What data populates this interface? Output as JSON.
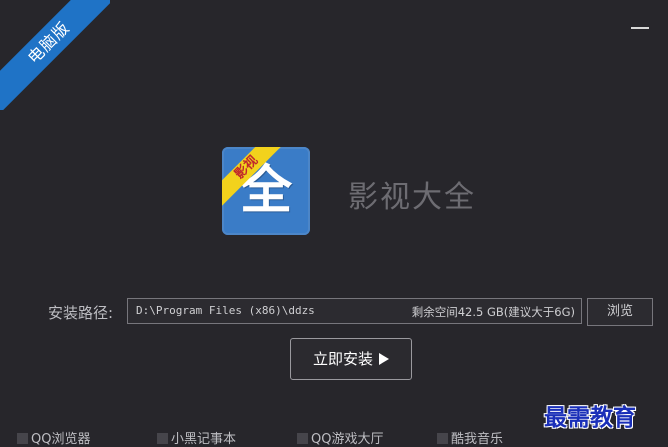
{
  "corner_ribbon": {
    "label": "电脑版"
  },
  "logo": {
    "char": "全",
    "band_label": "影视"
  },
  "app": {
    "name": "影视大全"
  },
  "install": {
    "path_label": "安装路径:",
    "path_value": "D:\\Program Files (x86)\\ddzs",
    "space_info": "剩余空间42.5 GB(建议大于6G)",
    "browse_label": "浏览",
    "install_label": "立即安装"
  },
  "bundles": [
    {
      "label": "QQ浏览器",
      "checked": false
    },
    {
      "label": "小黑记事本",
      "checked": false
    },
    {
      "label": "QQ游戏大厅",
      "checked": false
    },
    {
      "label": "酷我音乐",
      "checked": false
    }
  ],
  "watermark": {
    "text": "最需教育"
  },
  "colors": {
    "background": "#27262b",
    "ribbon": "#1f73c6",
    "logo_blue": "#3a7cc7",
    "logo_band": "#f2d21c"
  }
}
